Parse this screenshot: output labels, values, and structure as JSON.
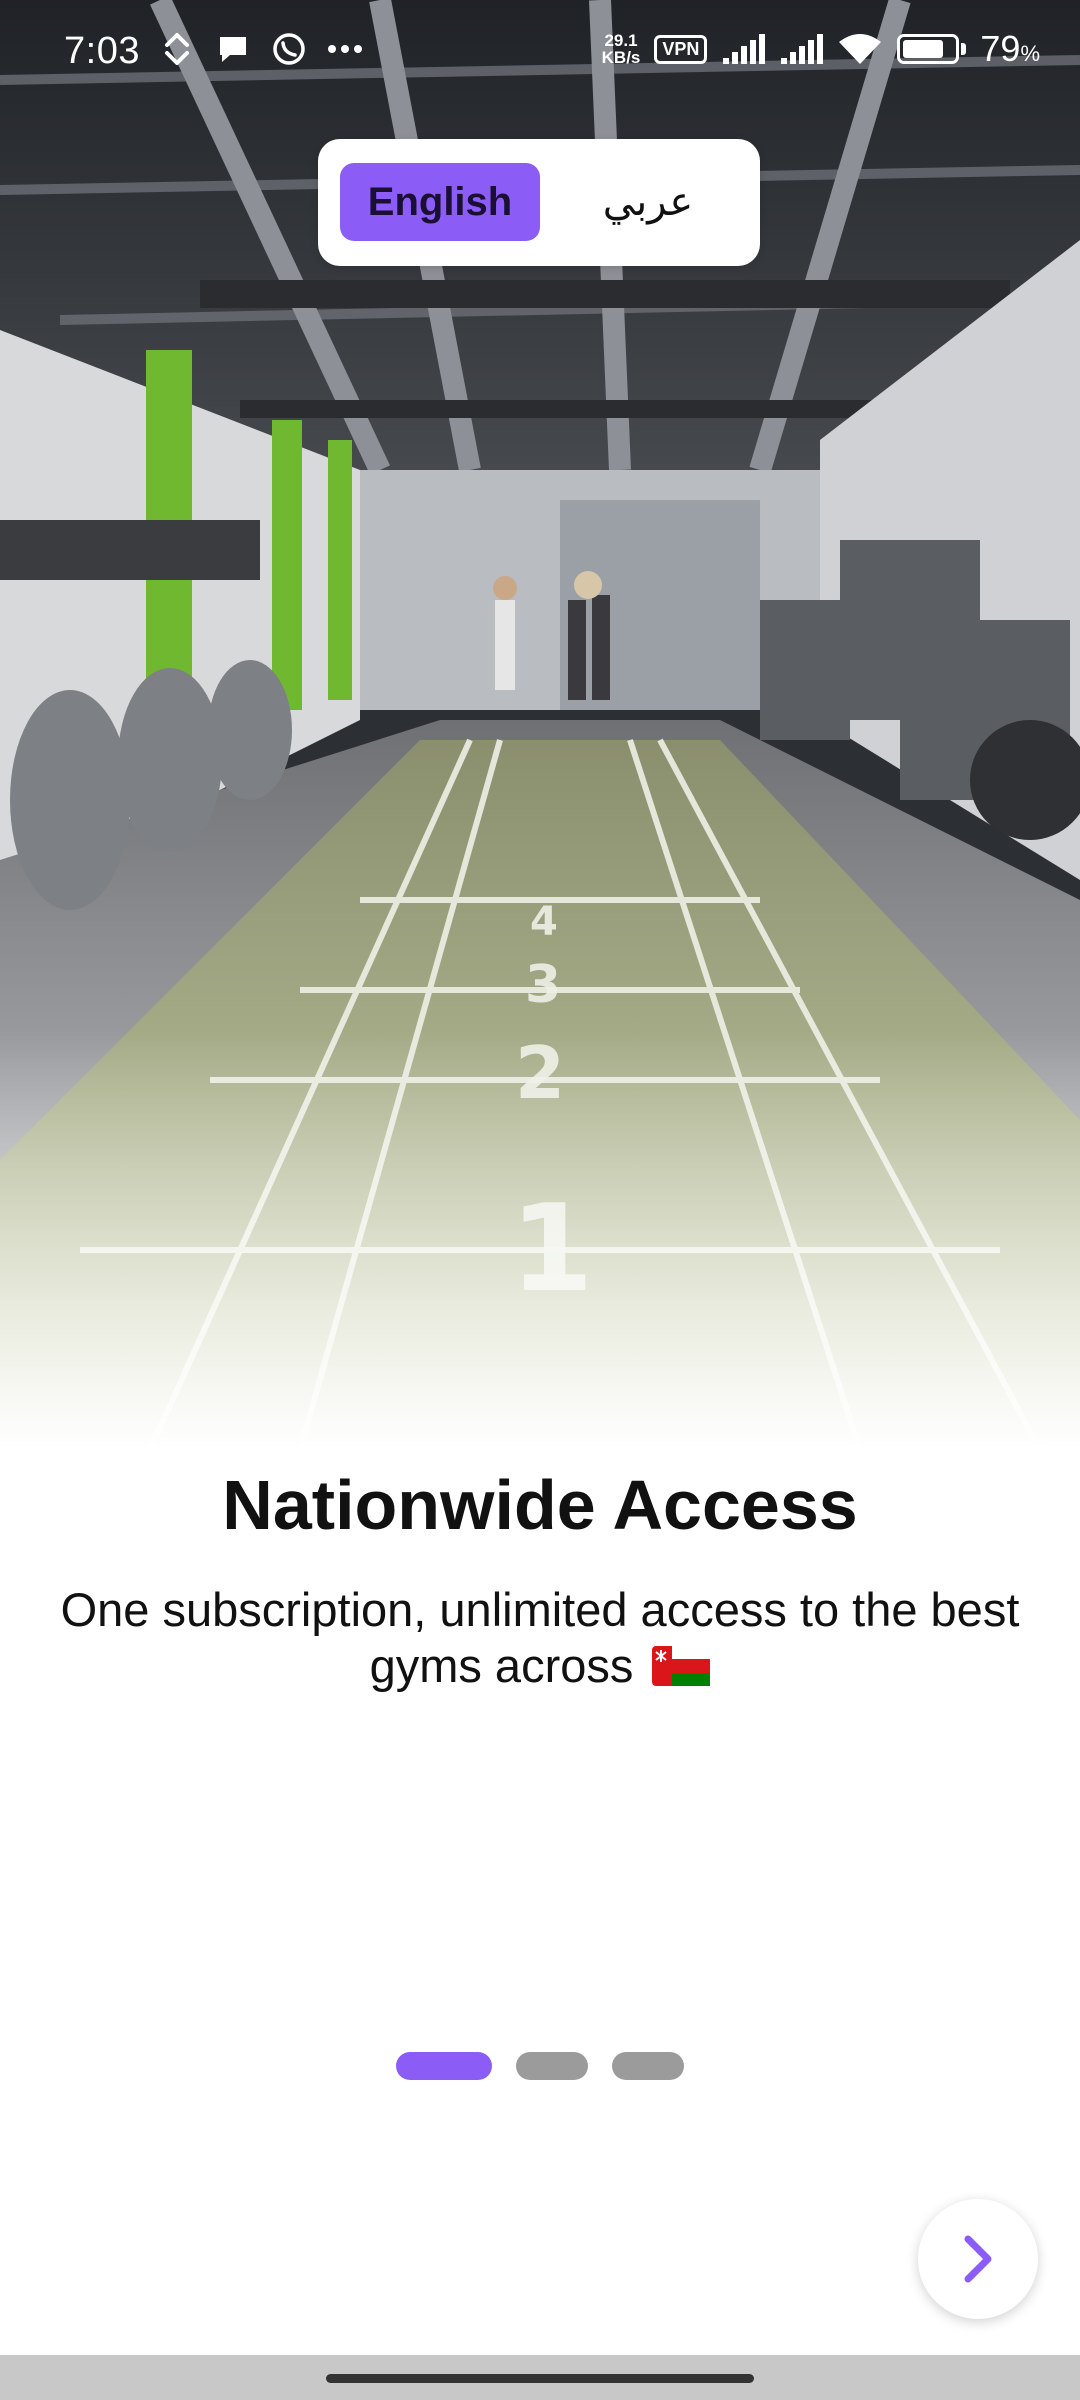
{
  "status_bar": {
    "time": "7:03",
    "net_speed_value": "29.1",
    "net_speed_unit": "KB/s",
    "vpn_label": "VPN",
    "battery_percent_value": "79",
    "battery_percent_sign": "%",
    "battery_level": 0.79
  },
  "language_switch": {
    "english_label": "English",
    "arabic_label": "عربي",
    "selected": "English"
  },
  "slide": {
    "title": "Nationwide Access",
    "description": "One subscription, unlimited access to the best gyms across"
  },
  "pagination": {
    "total": 3,
    "current": 1
  },
  "icons": {
    "next": "chevron-right-icon",
    "flag": "oman-flag-icon"
  },
  "colors": {
    "accent": "#8b5cf6",
    "dot_inactive": "#9b9b9b",
    "text": "#111111"
  }
}
